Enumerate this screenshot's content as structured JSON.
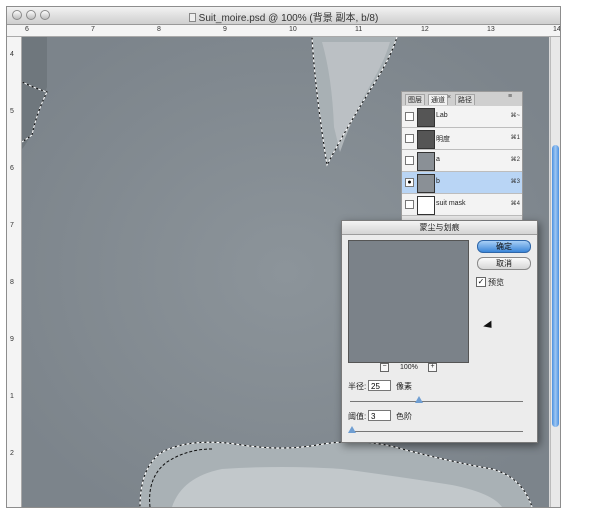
{
  "window": {
    "title": "Suit_moire.psd @ 100% (背景 副本, b/8)"
  },
  "rulers": {
    "horizontal_numbers": [
      "6",
      "7",
      "8",
      "9",
      "10",
      "11",
      "12",
      "13",
      "14"
    ],
    "vertical_numbers": [
      "4",
      "5",
      "6",
      "7",
      "8",
      "9",
      "1",
      "2"
    ]
  },
  "channels_panel": {
    "tabs": [
      "图层",
      "通道",
      "路径"
    ],
    "active_tab": "通道",
    "rows": [
      {
        "name": "Lab",
        "shortcut": "⌘~",
        "selected": false,
        "visible": false
      },
      {
        "name": "明度",
        "shortcut": "⌘1",
        "selected": false,
        "visible": false
      },
      {
        "name": "a",
        "shortcut": "⌘2",
        "selected": false,
        "visible": false
      },
      {
        "name": "b",
        "shortcut": "⌘3",
        "selected": true,
        "visible": true
      },
      {
        "name": "suit mask",
        "shortcut": "⌘4",
        "selected": false,
        "visible": false
      }
    ]
  },
  "dialog": {
    "title": "蒙尘与划痕",
    "ok_label": "确定",
    "cancel_label": "取消",
    "preview_label": "预览",
    "preview_checked": true,
    "zoom_label": "100%",
    "radius_label": "半径:",
    "radius_value": "25",
    "radius_unit": "像素",
    "radius_fraction": 0.4,
    "threshold_label": "阈值:",
    "threshold_value": "3",
    "threshold_unit": "色阶",
    "threshold_fraction": 0.01
  }
}
